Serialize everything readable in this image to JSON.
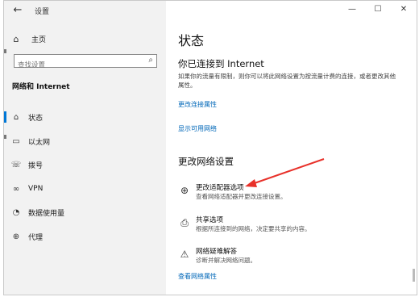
{
  "window": {
    "title": "设置",
    "back_icon": "←",
    "controls": [
      {
        "name": "minimize-button",
        "glyph": "—"
      },
      {
        "name": "maximize-button",
        "glyph": "☐"
      },
      {
        "name": "close-button",
        "glyph": "✕"
      }
    ]
  },
  "sidebar": {
    "home_label": "主页",
    "search_placeholder": "查找设置",
    "section_title": "网络和 Internet",
    "items": [
      {
        "label": "状态",
        "icon": "status-icon",
        "glyph": "⌂",
        "active": true
      },
      {
        "label": "以太网",
        "icon": "ethernet-icon",
        "glyph": "▭",
        "active": false
      },
      {
        "label": "拨号",
        "icon": "dialup-icon",
        "glyph": "☏",
        "active": false
      },
      {
        "label": "VPN",
        "icon": "vpn-icon",
        "glyph": "∞",
        "active": false
      },
      {
        "label": "数据使用量",
        "icon": "data-usage-icon",
        "glyph": "◔",
        "active": false
      },
      {
        "label": "代理",
        "icon": "proxy-icon",
        "glyph": "⊕",
        "active": false
      }
    ]
  },
  "main": {
    "title": "状态",
    "connected_heading": "你已连接到 Internet",
    "connected_desc": "如果你的流量有限制，则你可以将此网络设置为按流量计费的连接，或者更改其他属性。",
    "change_props_link": "更改连接属性",
    "show_networks_link": "显示可用网络",
    "change_settings_heading": "更改网络设置",
    "options": [
      {
        "title": "更改适配器选项",
        "desc": "查看网络适配器并更改连接设置。",
        "icon": "adapter-icon",
        "glyph": "⊕"
      },
      {
        "title": "共享选项",
        "desc": "根据所连接到的网络，决定要共享的内容。",
        "icon": "sharing-icon",
        "glyph": "⎙"
      },
      {
        "title": "网络疑难解答",
        "desc": "诊断并解决网络问题。",
        "icon": "warning-icon",
        "glyph": "⚠"
      }
    ],
    "view_props_link": "查看网络属性"
  },
  "colors": {
    "accent": "#0078d7",
    "link": "#0067b8",
    "arrow": "#e8312a"
  }
}
